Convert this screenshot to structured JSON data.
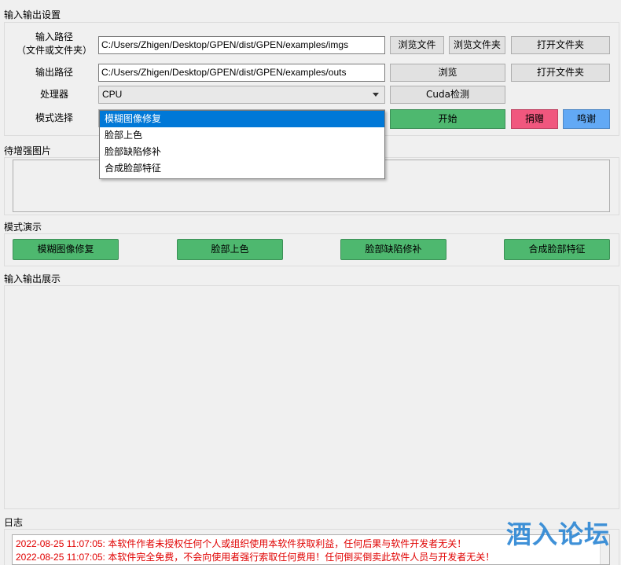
{
  "io_settings": {
    "title": "输入输出设置",
    "input_path_label_line1": "输入路径",
    "input_path_label_line2": "（文件或文件夹）",
    "input_path_value": "C:/Users/Zhigen/Desktop/GPEN/dist/GPEN/examples/imgs",
    "browse_file_label": "浏览文件",
    "browse_folder_label": "浏览文件夹",
    "open_folder_label_1": "打开文件夹",
    "output_path_label": "输出路径",
    "output_path_value": "C:/Users/Zhigen/Desktop/GPEN/dist/GPEN/examples/outs",
    "browse_label": "浏览",
    "open_folder_label_2": "打开文件夹",
    "processor_label": "处理器",
    "processor_value": "CPU",
    "cuda_check_label": "Cuda检测",
    "mode_label": "模式选择",
    "mode_options": [
      "模糊图像修复",
      "脸部上色",
      "脸部缺陷修补",
      "合成脸部特征"
    ],
    "start_label": "开始",
    "donate_label": "捐赠",
    "thanks_label": "鸣谢"
  },
  "to_enhance": {
    "title": "待增强图片"
  },
  "demo": {
    "title": "模式演示",
    "buttons": [
      "模糊图像修复",
      "脸部上色",
      "脸部缺陷修补",
      "合成脸部特征"
    ]
  },
  "io_display": {
    "title": "输入输出展示"
  },
  "log": {
    "title": "日志",
    "lines": [
      "2022-08-25 11:07:05: 本软件作者未授权任何个人或组织使用本软件获取利益，任何后果与软件开发者无关！",
      "2022-08-25 11:07:05: 本软件完全免费，不会向使用者强行索取任何费用！任何倒买倒卖此软件人员与开发者无关！"
    ]
  },
  "watermark": "酒入论坛",
  "colors": {
    "green": "#4eb86f",
    "pink": "#f0577e",
    "blue": "#62a9f5",
    "selection": "#0078d7",
    "log_text": "#e00000"
  }
}
